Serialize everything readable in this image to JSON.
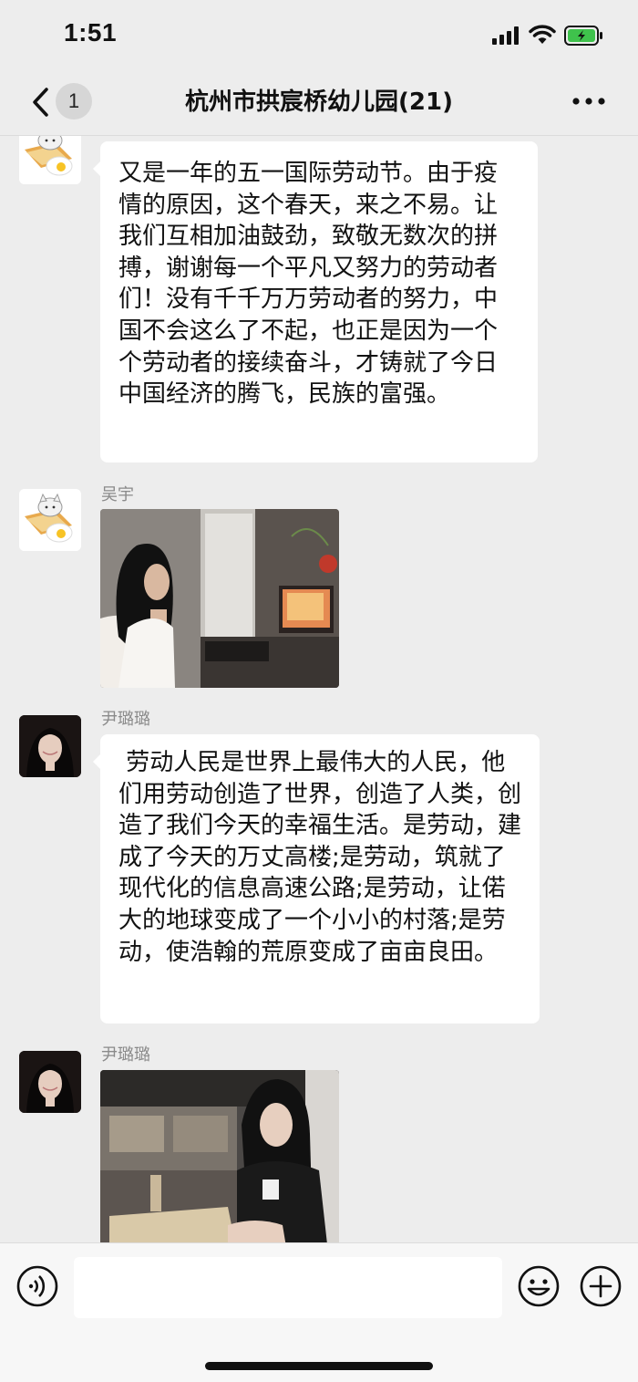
{
  "status_bar": {
    "time": "1:51"
  },
  "nav": {
    "unread_count": "1",
    "title": "杭州市拱宸桥幼儿园(21)"
  },
  "messages": [
    {
      "type": "text",
      "sender": "",
      "avatar": "cat-toast-avatar",
      "text": "又是一年的五一国际劳动节。由于疫情的原因，这个春天，来之不易。让我们互相加油鼓劲，致敬无数次的拼搏，谢谢每一个平凡又努力的劳动者们！没有千千万万劳动者的努力，中国不会这么了不起，也正是因为一个个劳动者的接续奋斗，才铸就了今日中国经济的腾飞，民族的富强。"
    },
    {
      "type": "image",
      "sender": "吴宇",
      "avatar": "cat-toast-avatar",
      "image": "girl-at-computer-photo"
    },
    {
      "type": "text",
      "sender": "尹璐璐",
      "avatar": "girl-portrait-avatar",
      "text": " 劳动人民是世界上最伟大的人民，他们用劳动创造了世界，创造了人类，创造了我们今天的幸福生活。是劳动，建成了今天的万丈高楼;是劳动，筑就了现代化的信息高速公路;是劳动，让偌大的地球变成了一个小小的村落;是劳动，使浩翰的荒原变成了亩亩良田。"
    },
    {
      "type": "image",
      "sender": "尹璐璐",
      "avatar": "girl-portrait-avatar",
      "image": "girl-at-desk-photo"
    }
  ],
  "input_bar": {
    "voice_icon": "voice-icon",
    "emoji_icon": "emoji-icon",
    "plus_icon": "plus-icon"
  },
  "colors": {
    "background": "#ededed",
    "bubble": "#ffffff",
    "battery_green": "#3fc24c",
    "sender_gray": "#8a8a8a"
  }
}
